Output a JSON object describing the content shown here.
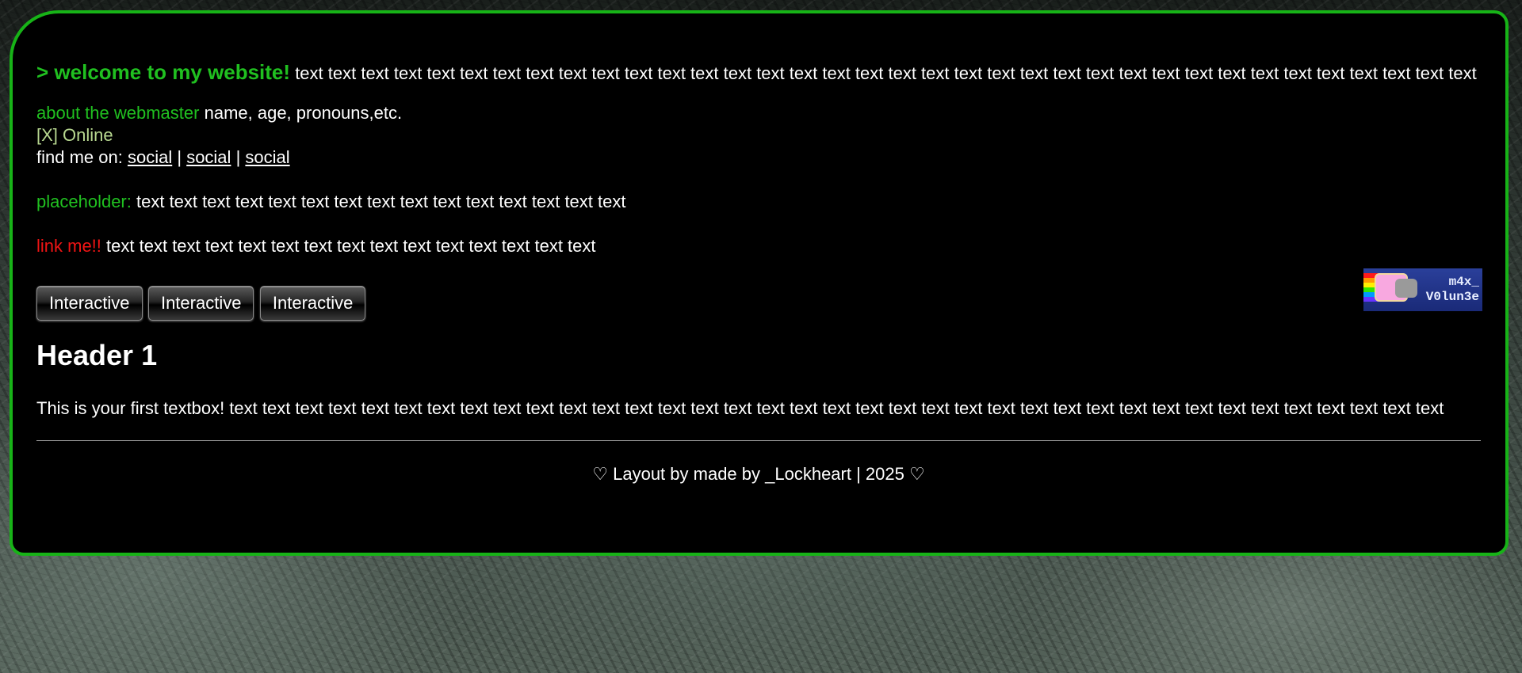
{
  "welcome": {
    "title": "> welcome to my website!",
    "text": "text text text text text text text text text text text text text text text text text text text text text text text text text text text text text text text text text text text text"
  },
  "about": {
    "label": "about the webmaster",
    "text": "name, age, pronouns,etc.",
    "status": "[X] Online",
    "find_label": "find me on:",
    "social_links": [
      "social",
      "social",
      "social"
    ],
    "separator": "|"
  },
  "placeholder": {
    "label": "placeholder:",
    "text": "text text text text text text text text text text text text text text text"
  },
  "linkme": {
    "label": "link me!!",
    "text": "text text text text text text text text text text text text text text text"
  },
  "buttons": [
    "Interactive",
    "Interactive",
    "Interactive"
  ],
  "header1": "Header 1",
  "textbox": "This is your first textbox! text text text text text text text text text text text text text text text text text text text text text text text text text text text text text text text text text text text text text",
  "footer": "♡ Layout by made by _Lockheart | 2025 ♡",
  "badge": {
    "line1": "m4x_",
    "line2": "V0lun3e"
  },
  "colors": {
    "accent": "#20c020",
    "border": "#17b317",
    "link_me": "#f01414",
    "online": "#b8d890"
  }
}
